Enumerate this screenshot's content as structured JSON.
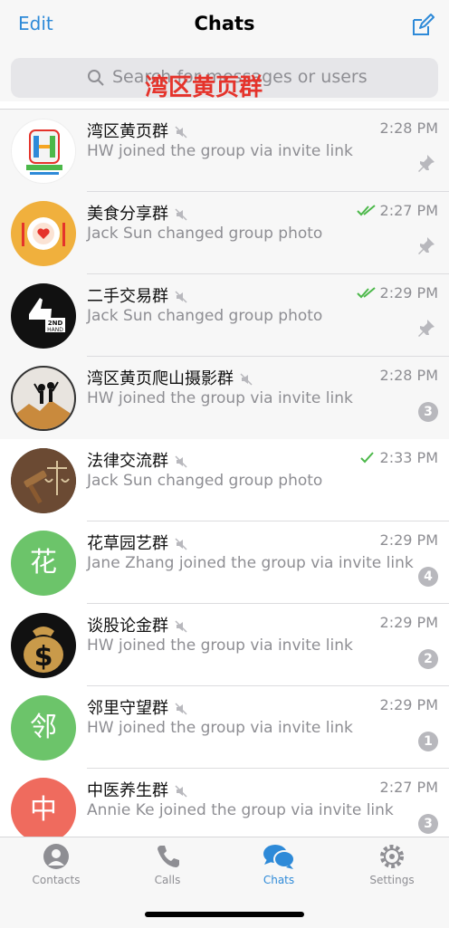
{
  "nav": {
    "edit_label": "Edit",
    "title": "Chats",
    "compose_icon": "compose-icon"
  },
  "search": {
    "placeholder": "Search for messages or users"
  },
  "overlay_title": "湾区黄页群",
  "colors": {
    "accent": "#2e8ad8",
    "check_green": "#4cb84a",
    "badge_gray": "#b8b8bd"
  },
  "chats": [
    {
      "title": "湾区黄页群",
      "time": "2:28 PM",
      "subtitle": "HW joined the group via invite link",
      "pinned": true
    },
    {
      "title": "美食分享群",
      "time": "2:27 PM",
      "subtitle": "Jack Sun changed group photo",
      "pinned": true,
      "read": "double"
    },
    {
      "title": "二手交易群",
      "time": "2:29 PM",
      "subtitle": "Jack Sun changed group photo",
      "pinned": true,
      "read": "double"
    },
    {
      "title": "湾区黄页爬山摄影群",
      "time": "2:28 PM",
      "subtitle": "HW joined the group via invite link",
      "badge": "3"
    },
    {
      "title": "法律交流群",
      "time": "2:33 PM",
      "subtitle": "Jack Sun changed group photo",
      "read": "single"
    },
    {
      "title": "花草园艺群",
      "time": "2:29 PM",
      "subtitle": "Jane Zhang joined the group via invite link",
      "badge": "4",
      "avatar_letter": "花"
    },
    {
      "title": "谈股论金群",
      "time": "2:29 PM",
      "subtitle": "HW joined the group via invite link",
      "badge": "2"
    },
    {
      "title": "邻里守望群",
      "time": "2:29 PM",
      "subtitle": "HW joined the group via invite link",
      "badge": "1",
      "avatar_letter": "邻"
    },
    {
      "title": "中医养生群",
      "time": "2:27 PM",
      "subtitle": "Annie Ke joined the group via invite link",
      "badge": "3",
      "avatar_letter": "中"
    }
  ],
  "tabs": [
    {
      "label": "Contacts",
      "icon": "person-icon"
    },
    {
      "label": "Calls",
      "icon": "phone-icon"
    },
    {
      "label": "Chats",
      "icon": "chat-bubbles-icon",
      "active": true
    },
    {
      "label": "Settings",
      "icon": "gear-icon"
    }
  ]
}
